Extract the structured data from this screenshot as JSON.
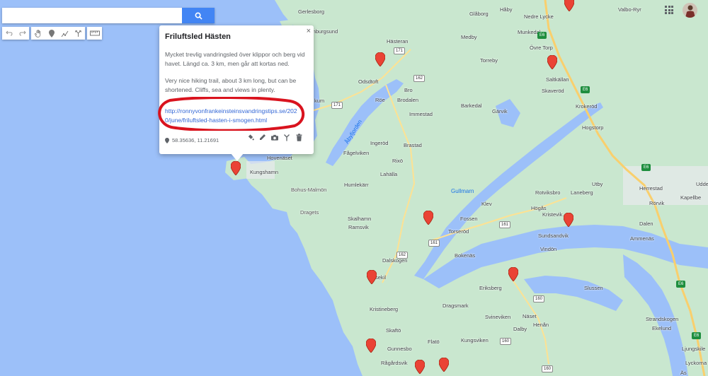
{
  "search": {
    "placeholder": "",
    "value": ""
  },
  "toolbar": {
    "undo_icon": "undo-icon",
    "redo_icon": "redo-icon",
    "hand_icon": "hand-icon",
    "marker_icon": "add-marker-icon",
    "line_icon": "draw-line-icon",
    "directions_icon": "directions-icon",
    "measure_icon": "ruler-icon"
  },
  "popup": {
    "title": "Friluftsled Hästen",
    "close": "×",
    "desc_sv": "Mycket trevlig vandringsled över klippor och berg vid havet. Längd ca. 3 km, men går att kortas ned.",
    "desc_en": "Very nice hiking trail, about 3 km long, but can be shortened. Cliffs, sea and views in plenty.",
    "link": "http://ronnyvonfrankeinsteinsvandringstips.se/2020/june/friluftsled-hasten-i-smogen.html",
    "coords": "58.35636, 11.21691",
    "highlight_color": "#d9131e"
  },
  "places": [
    {
      "name": "Gerlesborg"
    },
    {
      "name": "Hamburgsund"
    },
    {
      "name": "Hästeran"
    },
    {
      "name": "Glåborg"
    },
    {
      "name": "Håby"
    },
    {
      "name": "Nedre Lycke"
    },
    {
      "name": "Valbo-Ryr"
    },
    {
      "name": "Medby"
    },
    {
      "name": "Munkedal"
    },
    {
      "name": "Övre Torp"
    },
    {
      "name": "Torreby"
    },
    {
      "name": "Saltkällan"
    },
    {
      "name": "Skaveröd"
    },
    {
      "name": "Krokeröd"
    },
    {
      "name": "Hogstorp"
    },
    {
      "name": "Odsdtoft"
    },
    {
      "name": "Bro"
    },
    {
      "name": "Brodalen"
    },
    {
      "name": "Barkedal"
    },
    {
      "name": "Gärvik"
    },
    {
      "name": "Immestad"
    },
    {
      "name": "Röe"
    },
    {
      "name": "kum"
    },
    {
      "name": "Åbyfjorden"
    },
    {
      "name": "Ingeröd"
    },
    {
      "name": "Brastad"
    },
    {
      "name": "Fågelviken"
    },
    {
      "name": "Hovenäset"
    },
    {
      "name": "Kungshamn"
    },
    {
      "name": "Rixö"
    },
    {
      "name": "Lahälla"
    },
    {
      "name": "Humlekärr"
    },
    {
      "name": "Bohus-Malmön"
    },
    {
      "name": "Dragets"
    },
    {
      "name": "Skalhamn"
    },
    {
      "name": "Ramsvik"
    },
    {
      "name": "Gullmarn"
    },
    {
      "name": "Klev"
    },
    {
      "name": "Fossen"
    },
    {
      "name": "Torseröd"
    },
    {
      "name": "Rotviksbro"
    },
    {
      "name": "Laneberg"
    },
    {
      "name": "Utby"
    },
    {
      "name": "Herrestad"
    },
    {
      "name": "Udde"
    },
    {
      "name": "Kapellbe"
    },
    {
      "name": "Rörvik"
    },
    {
      "name": "Högås"
    },
    {
      "name": "Kristevik"
    },
    {
      "name": "Sundsandvik"
    },
    {
      "name": "Dalen"
    },
    {
      "name": "Ammenäs"
    },
    {
      "name": "Vindön"
    },
    {
      "name": "Bokenäs"
    },
    {
      "name": "Dalskogen"
    },
    {
      "name": "sekil"
    },
    {
      "name": "Eriksberg"
    },
    {
      "name": "Slussen"
    },
    {
      "name": "Dragsmark"
    },
    {
      "name": "Kristineberg"
    },
    {
      "name": "Näset"
    },
    {
      "name": "Svineviken"
    },
    {
      "name": "Henån"
    },
    {
      "name": "Dalby"
    },
    {
      "name": "Strandskogen"
    },
    {
      "name": "Ekelund"
    },
    {
      "name": "Ljungskile"
    },
    {
      "name": "Skaftö"
    },
    {
      "name": "Flatö"
    },
    {
      "name": "Kungsviken"
    },
    {
      "name": "Gunnesbo"
    },
    {
      "name": "Rågårdsvik"
    },
    {
      "name": "Lyckorna"
    },
    {
      "name": "Äs"
    }
  ],
  "roads": [
    {
      "num": "171"
    },
    {
      "num": "171"
    },
    {
      "num": "162"
    },
    {
      "num": "162"
    },
    {
      "num": "161"
    },
    {
      "num": "161"
    },
    {
      "num": "160"
    },
    {
      "num": "160"
    },
    {
      "num": "160"
    },
    {
      "num": "E6"
    },
    {
      "num": "E6"
    },
    {
      "num": "E6"
    },
    {
      "num": "E6"
    },
    {
      "num": "E6"
    }
  ],
  "colors": {
    "water": "#9cc0f9",
    "land": "#c9e7cf",
    "marker": "#ea4335",
    "accent": "#4285f4"
  }
}
